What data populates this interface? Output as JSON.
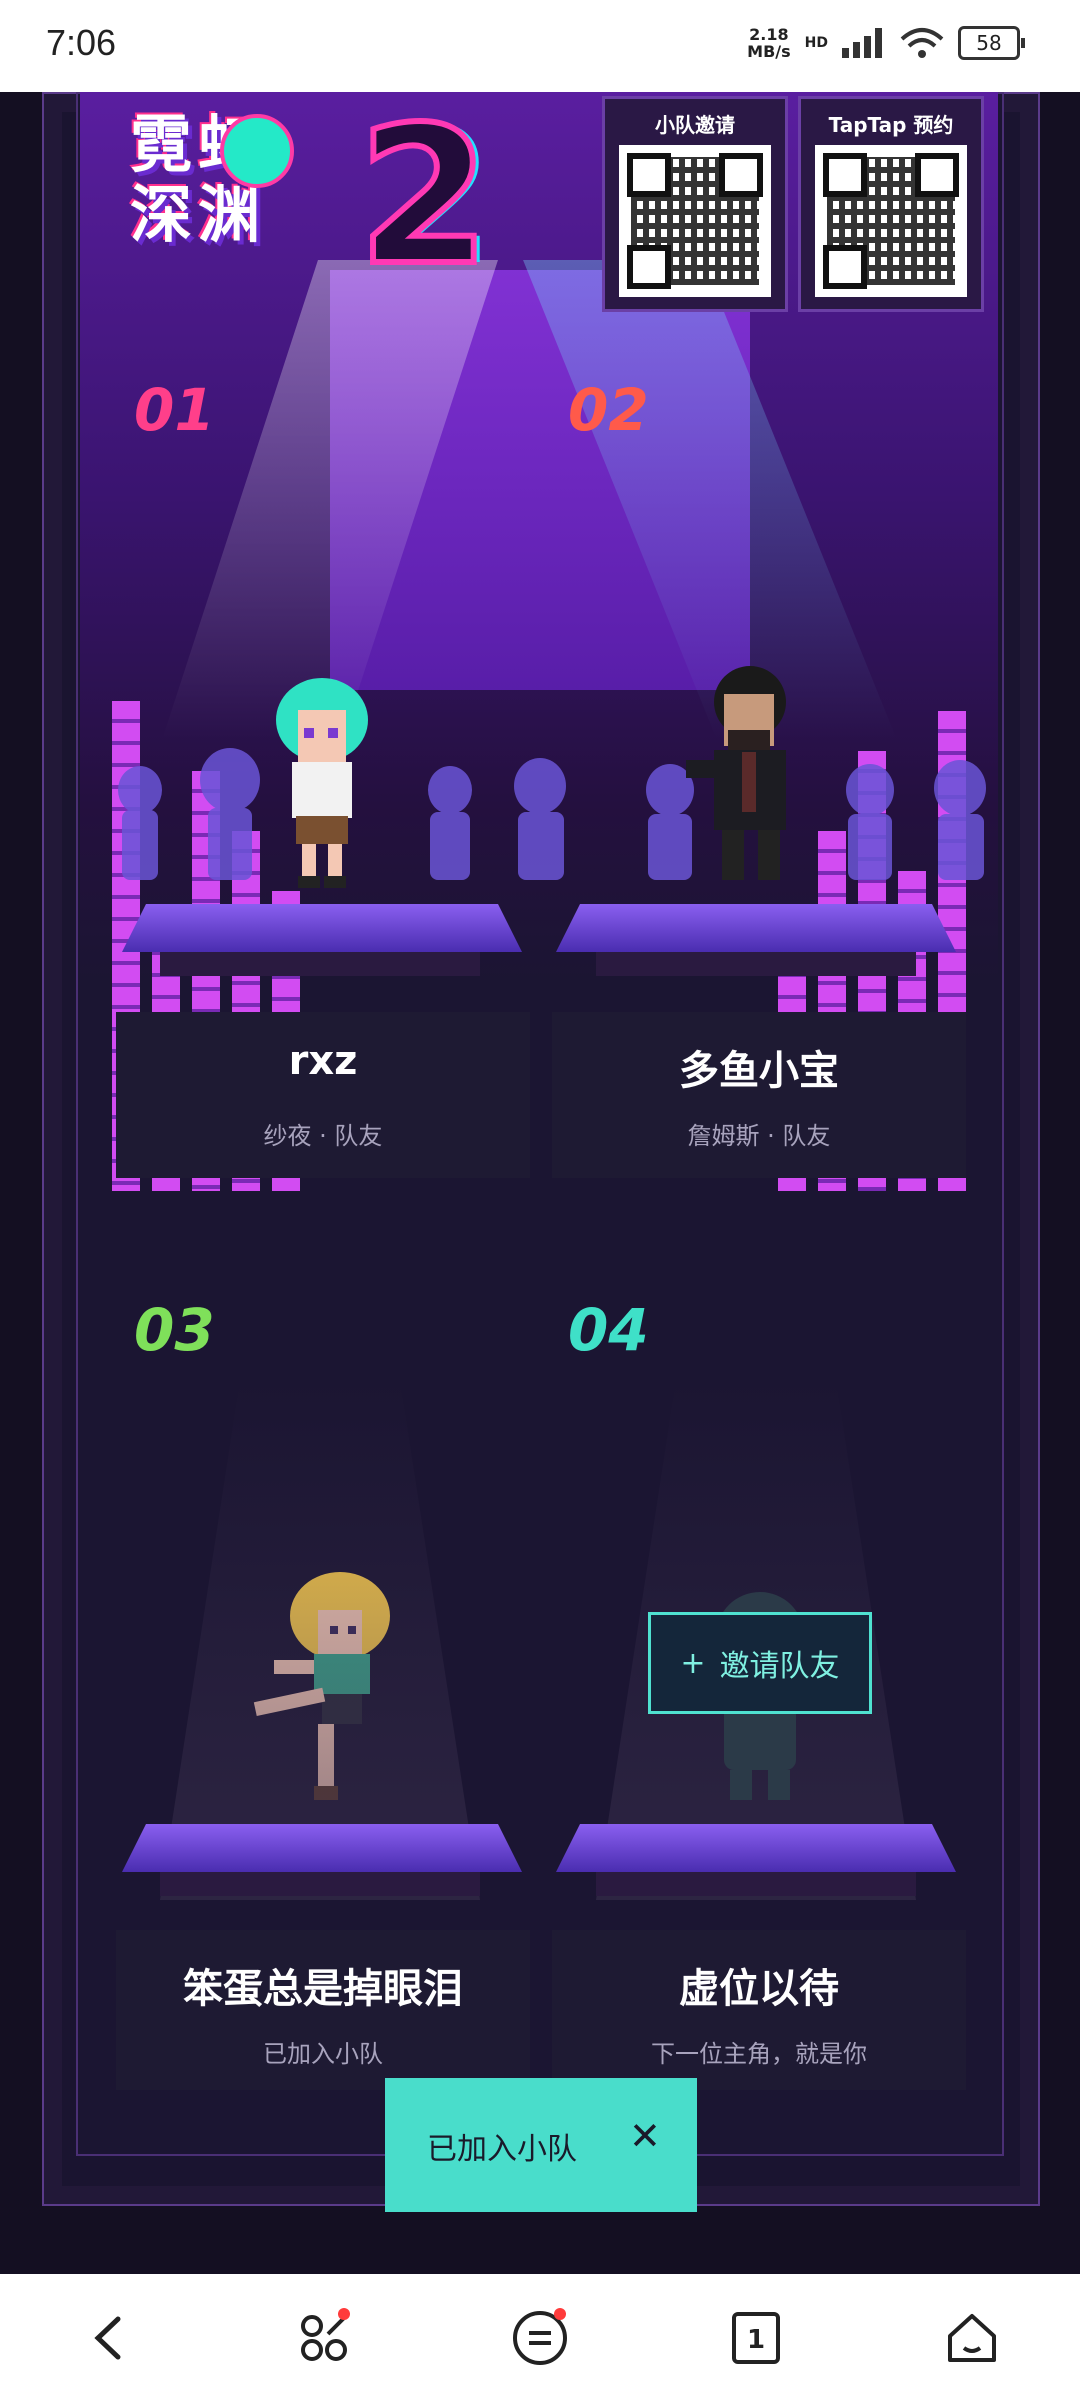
{
  "status_bar": {
    "time": "7:06",
    "net_speed": "2.18",
    "net_unit": "MB/s",
    "hd": "HD",
    "battery": "58"
  },
  "logo": {
    "line1": "霓虹",
    "line2": "深渊",
    "number": "2"
  },
  "qr_cards": [
    {
      "title": "小队邀请"
    },
    {
      "title": "TapTap 预约"
    }
  ],
  "slots": [
    {
      "number": "01",
      "name": "rxz",
      "subtitle": "纱夜 · 队友",
      "color": "#ff3f8a"
    },
    {
      "number": "02",
      "name": "多鱼小宝",
      "subtitle": "詹姆斯 · 队友",
      "color": "#ff5a4a"
    },
    {
      "number": "03",
      "name": "笨蛋总是掉眼泪",
      "subtitle": "已加入小队",
      "color": "#7fe05a"
    },
    {
      "number": "04",
      "name": "虚位以待",
      "subtitle": "下一位主角，就是你",
      "color": "#3fe0c8"
    }
  ],
  "invite_button": {
    "icon": "+",
    "label": "邀请队友"
  },
  "toast": {
    "text": "已加入小队",
    "close": "✕"
  },
  "nav": {
    "icons": [
      "back-icon",
      "apps-icon",
      "menu-icon",
      "tabs-icon",
      "home-icon"
    ],
    "tabs_count": "1"
  },
  "colors": {
    "accent": "#49ddcb",
    "stage_purple": "#6020b8"
  }
}
